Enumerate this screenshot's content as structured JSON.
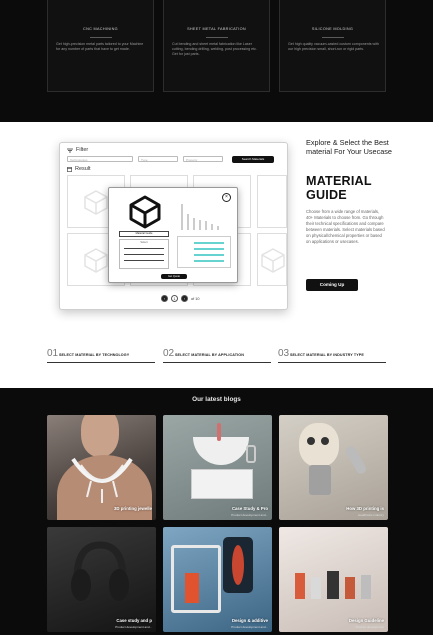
{
  "services": [
    {
      "title": "CNC MACHINING",
      "desc": "Get high-precision metal parts tailored to your Machine for any number of parts that have to get made."
    },
    {
      "title": "SHEET METAL FABRICATION",
      "desc": "Cut bending and sheet metal fabrication like Laser cutting, bending drilling, welding, post processing etc. Get for just parts."
    },
    {
      "title": "SILICONE MOLDING",
      "desc": "Get high quality vacuum-casted custom components with our high precision small, short-run or rigid parts."
    }
  ],
  "guide": {
    "subtitle": "Explore & Select the Best material For Your Usecase",
    "title_line1": "MATERIAL",
    "title_line2": "GUIDE",
    "description": "Choose from a wide range of materials, 40+ Materials to choose from. Go through their technical specifications and compare between materials. Select materials based on physical/chemical properties or based on applications or usecases.",
    "cta": "Coming Up",
    "mock": {
      "filter_label": "Filter",
      "inputs": [
        "Technologies",
        "Type",
        "Property"
      ],
      "search_label": "Search Materials",
      "result_label": "Result",
      "modal_label": "Material Guide",
      "modal_select": "Select",
      "modal_button": "Get Quote",
      "pager": {
        "current": "1",
        "of_label": "of 10"
      }
    },
    "tabs": [
      {
        "num": "01",
        "label": "SELECT MATERIAL BY TECHNOLOGY"
      },
      {
        "num": "02",
        "label": "SELECT MATERIAL BY APPLICATION"
      },
      {
        "num": "03",
        "label": "SELECT MATERIAL BY INDUSTRY TYPE"
      }
    ]
  },
  "blogs": {
    "title": "Our latest blogs",
    "items": [
      {
        "caption": "3D printing jewelle",
        "sub": ""
      },
      {
        "caption": "Case Study & Pro",
        "sub": "Product development and..."
      },
      {
        "caption": "How 3D printing is",
        "sub": "Healthcare industry"
      },
      {
        "caption": "Case study and p",
        "sub": "Product development and..."
      },
      {
        "caption": "Design & additive",
        "sub": "Product development and..."
      },
      {
        "caption": "Design Guideline",
        "sub": "Product development"
      }
    ]
  }
}
